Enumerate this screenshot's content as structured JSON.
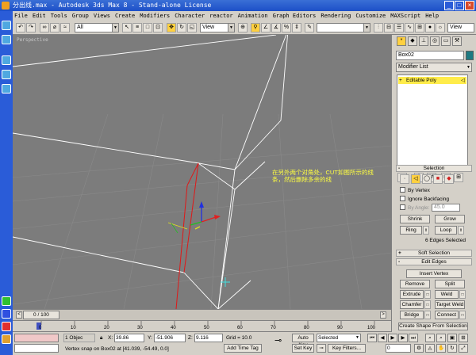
{
  "window": {
    "title": "分出线.max - Autodesk 3ds Max 8  - Stand-alone License",
    "min": "_",
    "max": "□",
    "close": "×"
  },
  "menu": [
    "File",
    "Edit",
    "Tools",
    "Group",
    "Views",
    "Create",
    "Modifiers",
    "Character",
    "reactor",
    "Animation",
    "Graph Editors",
    "Rendering",
    "Customize",
    "MAXScript",
    "Help"
  ],
  "toolbar": {
    "filter_value": "All",
    "refcoord_value": "View",
    "named_sel_value": "",
    "right_view_value": "View"
  },
  "viewport": {
    "label": "Perspective",
    "annotation": "在另外两个对角处，CUT如图所示的线条，然后删除多余的线"
  },
  "command_panel": {
    "object_name": "Box02",
    "object_color": "#1e7a82",
    "modifier_list": "Modifier List",
    "stack_item": "Editable Poly",
    "selection_title": "Selection",
    "by_vertex": "By Vertex",
    "ignore_backfacing": "Ignore Backfacing",
    "by_angle": "By Angle:",
    "by_angle_value": "45.0",
    "shrink": "Shrink",
    "grow": "Grow",
    "ring": "Ring",
    "loop": "Loop",
    "selected_info": "6 Edges Selected",
    "soft_selection_title": "Soft Selection",
    "edit_edges_title": "Edit Edges",
    "insert_vertex": "Insert Vertex",
    "remove": "Remove",
    "split": "Split",
    "extrude": "Extrude",
    "weld": "Weld",
    "chamfer": "Chamfer",
    "target_weld": "Target Weld",
    "bridge": "Bridge",
    "connect": "Connect",
    "create_shape": "Create Shape From Selection"
  },
  "timeline": {
    "frame": "0 / 100",
    "ticks": [
      "0",
      "10",
      "20",
      "30",
      "40",
      "50",
      "60",
      "70",
      "80",
      "90",
      "100"
    ]
  },
  "status": {
    "objects": "1 Objec",
    "prompt": "Vertex snap on Box02 at [41.039, -54.49, 0.0]",
    "x_label": "X:",
    "x_value": "39.86",
    "y_label": "Y:",
    "y_value": "-51.906",
    "z_label": "Z:",
    "z_value": "9.116",
    "grid": "Grid = 10.0",
    "add_time_tag": "Add Time Tag",
    "auto_key": "Auto Key",
    "set_key": "Set Key",
    "key_mode": "Selected",
    "key_filters": "Key Filters...",
    "current_frame": "0"
  }
}
